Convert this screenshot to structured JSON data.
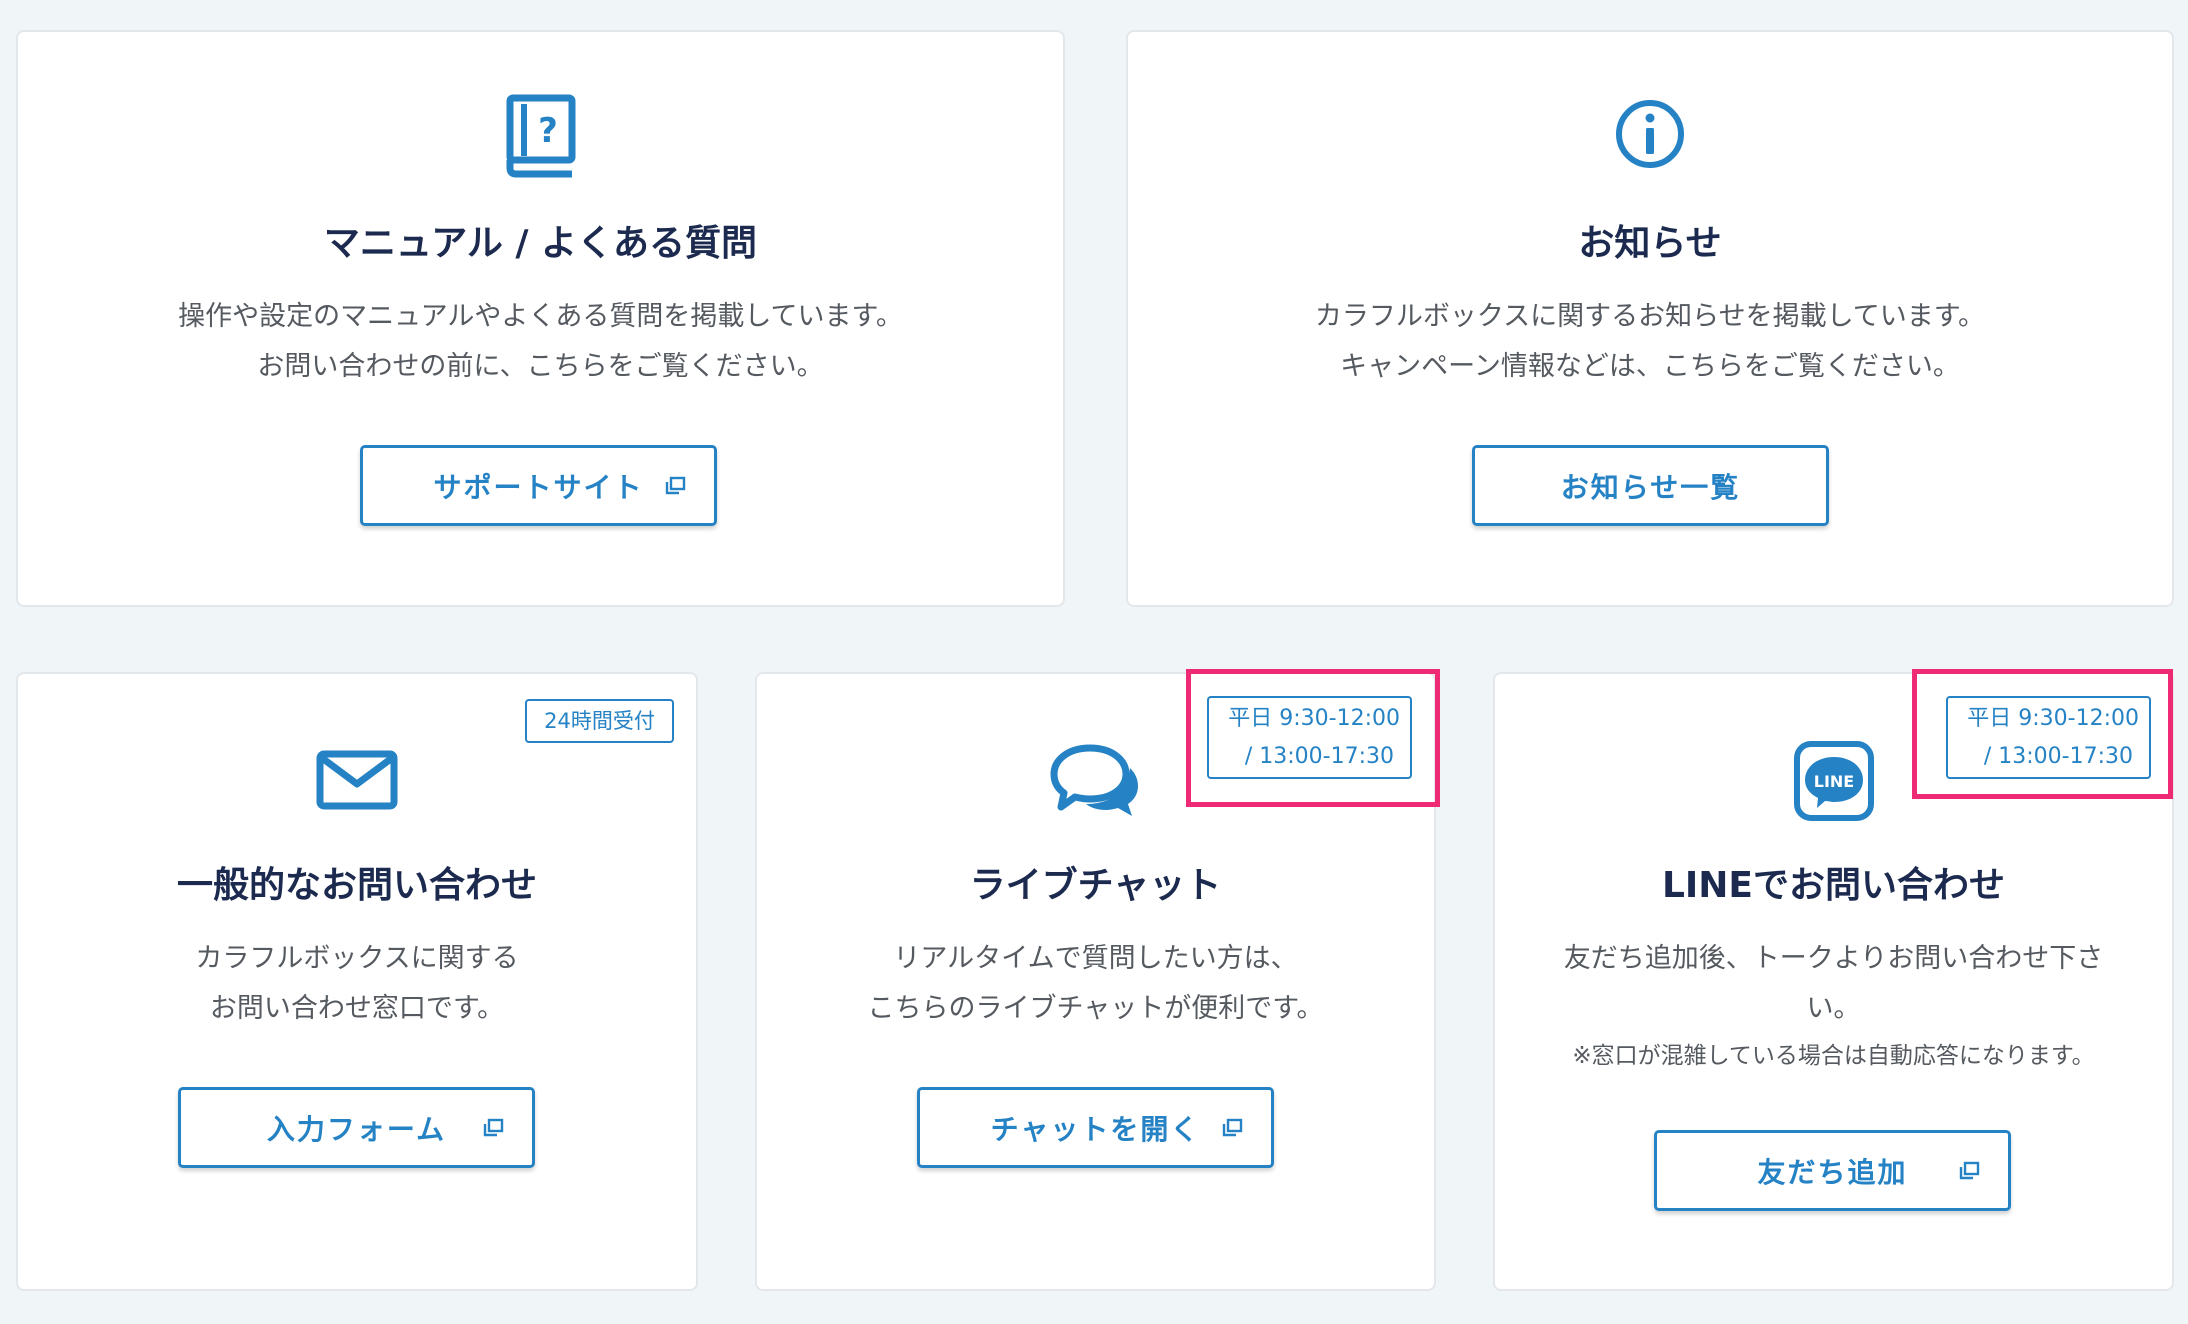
{
  "colors": {
    "accent": "#2582c4",
    "title_text": "#1b2a4e",
    "body_text": "#555a60",
    "highlight": "#ee2a74",
    "page_background": "#f0f5f7"
  },
  "manual": {
    "icon": "book-question-icon",
    "title": "マニュアル / よくある質問",
    "desc_line1": "操作や設定のマニュアルやよくある質問を掲載しています。",
    "desc_line2": "お問い合わせの前に、こちらをご覧ください。",
    "button_label": "サポートサイト",
    "button_icon": "external-link-icon"
  },
  "news": {
    "icon": "info-circle-icon",
    "title": "お知らせ",
    "desc_line1": "カラフルボックスに関するお知らせを掲載しています。",
    "desc_line2": "キャンペーン情報などは、こちらをご覧ください。",
    "button_label": "お知らせ一覧"
  },
  "mail": {
    "icon": "envelope-icon",
    "badge": "24時間受付",
    "title": "一般的なお問い合わせ",
    "desc_line1": "カラフルボックスに関する",
    "desc_line2": "お問い合わせ窓口です。",
    "button_label": "入力フォーム",
    "button_icon": "external-link-icon"
  },
  "chat": {
    "icon": "chat-bubbles-icon",
    "hours_line1": "平日 9:30-12:00",
    "hours_line2": "/ 13:00-17:30",
    "title": "ライブチャット",
    "desc_line1": "リアルタイムで質問したい方は、",
    "desc_line2": "こちらのライブチャットが便利です。",
    "button_label": "チャットを開く",
    "button_icon": "external-link-icon"
  },
  "line": {
    "icon": "line-app-icon",
    "icon_text": "LINE",
    "hours_line1": "平日 9:30-12:00",
    "hours_line2": "/ 13:00-17:30",
    "title": "LINEでお問い合わせ",
    "desc_line1": "友だち追加後、トークよりお問い合わせ下さ",
    "desc_line2": "い。",
    "note": "※窓口が混雑している場合は自動応答になります。",
    "button_label": "友だち追加",
    "button_icon": "external-link-icon"
  }
}
